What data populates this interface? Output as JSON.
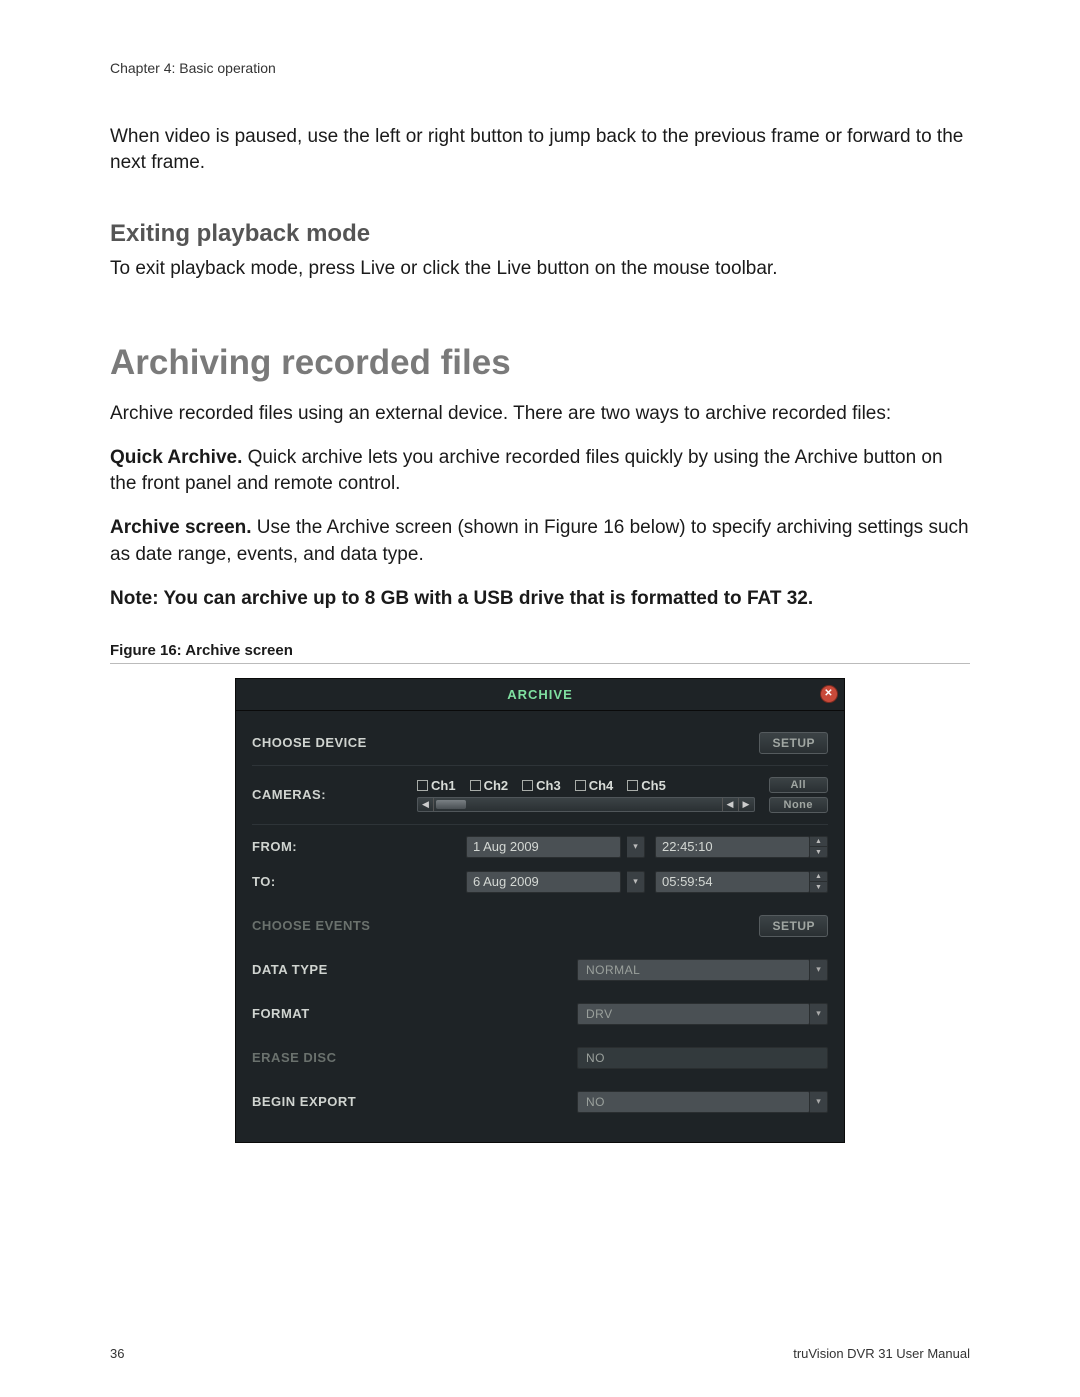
{
  "chapter_header": "Chapter 4: Basic operation",
  "intro": "When video is paused, use the left or right button to jump back to the previous frame or forward to the next frame.",
  "exit_heading": "Exiting playback mode",
  "exit_text": "To exit playback mode, press Live or click the Live button on the mouse toolbar.",
  "archive_heading": "Archiving recorded files",
  "archive_intro": "Archive recorded files using an external device. There are two ways to archive recorded files:",
  "quick_label": "Quick Archive.",
  "quick_text": " Quick archive lets you archive recorded files quickly by using the Archive button on the front panel and remote control.",
  "screen_label": "Archive screen.",
  "screen_text": " Use the Archive screen (shown in Figure 16 below) to specify archiving settings such as date range, events, and data type.",
  "note_text": "Note: You can archive up to 8 GB with a USB drive that is formatted to FAT 32.",
  "figure_caption": "Figure 16: Archive screen",
  "panel": {
    "title": "ARCHIVE",
    "choose_device": "CHOOSE DEVICE",
    "setup": "SETUP",
    "cameras_label": "CAMERAS:",
    "channels": [
      "Ch1",
      "Ch2",
      "Ch3",
      "Ch4",
      "Ch5"
    ],
    "all": "All",
    "none": "None",
    "from_label": "FROM:",
    "from_date": "1 Aug 2009",
    "from_time": "22:45:10",
    "to_label": "TO:",
    "to_date": "6 Aug 2009",
    "to_time": "05:59:54",
    "choose_events": "CHOOSE EVENTS",
    "data_type_label": "DATA TYPE",
    "data_type_value": "NORMAL",
    "format_label": "FORMAT",
    "format_value": "DRV",
    "erase_label": "ERASE DISC",
    "erase_value": "NO",
    "begin_label": "BEGIN EXPORT",
    "begin_value": "NO"
  },
  "footer": {
    "page": "36",
    "doc": "truVision DVR 31 User Manual"
  }
}
